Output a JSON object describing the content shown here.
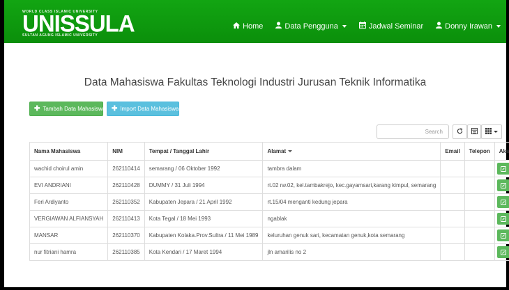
{
  "brand": {
    "top_text": "WORLD CLASS ISLAMIC UNIVERSITY",
    "logo_text": "UNISSULA",
    "bottom_text": "SULTAN AGUNG ISLAMIC UNIVERSITY"
  },
  "nav": {
    "home": "Home",
    "data_pengguna": "Data Pengguna",
    "jadwal_seminar": "Jadwal Seminar",
    "user": "Donny Irawan"
  },
  "page_title": "Data Mahasiswa Fakultas Teknologi Industri Jurusan Teknik Informatika",
  "buttons": {
    "add": "Tambah Data Mahasiswa",
    "import": "Import Data Mahasiswa"
  },
  "search": {
    "placeholder": "Search"
  },
  "table": {
    "headers": [
      "Nama Mahasiswa",
      "NIM",
      "Tempat / Tanggal Lahir",
      "Alamat",
      "Email",
      "Telepon",
      "Aksi"
    ],
    "rows": [
      {
        "nama": "wachid choirul amin",
        "nim": "262110414",
        "ttl": "semarang / 06 Oktober 1992",
        "alamat": "tambra dalam",
        "email": "",
        "telepon": ""
      },
      {
        "nama": "EVI ANDRIANI",
        "nim": "262110428",
        "ttl": "DUMMY / 31 Juli 1994",
        "alamat": "rt.02 rw.02, kel.tambakrejo, kec.gayamsari,karang kimpul, semarang",
        "email": "",
        "telepon": ""
      },
      {
        "nama": "Feri Ardiyanto",
        "nim": "262110352",
        "ttl": "Kabupaten Jepara / 21 April 1992",
        "alamat": "rt.15/04 menganti kedung jepara",
        "email": "",
        "telepon": ""
      },
      {
        "nama": "VERGIAWAN ALFIANSYAH",
        "nim": "262110413",
        "ttl": "Kota Tegal / 18 Mei 1993",
        "alamat": "ngablak",
        "email": "",
        "telepon": ""
      },
      {
        "nama": "MANSAR",
        "nim": "262110370",
        "ttl": "Kabupaten Kolaka.Prov.Sultra / 11 Mei 1989",
        "alamat": "keluruhan genuk sari, kecamatan genuk,kota semarang",
        "email": "",
        "telepon": ""
      },
      {
        "nama": "nur fitriani hamra",
        "nim": "262110385",
        "ttl": "Kota Kendari / 17 Maret 1994",
        "alamat": "jln amarilis no 2",
        "email": "",
        "telepon": ""
      }
    ]
  },
  "colors": {
    "navbar": "#0f9b0f",
    "success": "#5cb85c",
    "info": "#5bc0de"
  },
  "icons": {
    "home": "home-icon",
    "user": "user-icon",
    "calendar": "calendar-icon",
    "refresh": "refresh-icon",
    "toggle": "list-icon",
    "columns": "grid-icon",
    "edit": "edit-icon"
  }
}
